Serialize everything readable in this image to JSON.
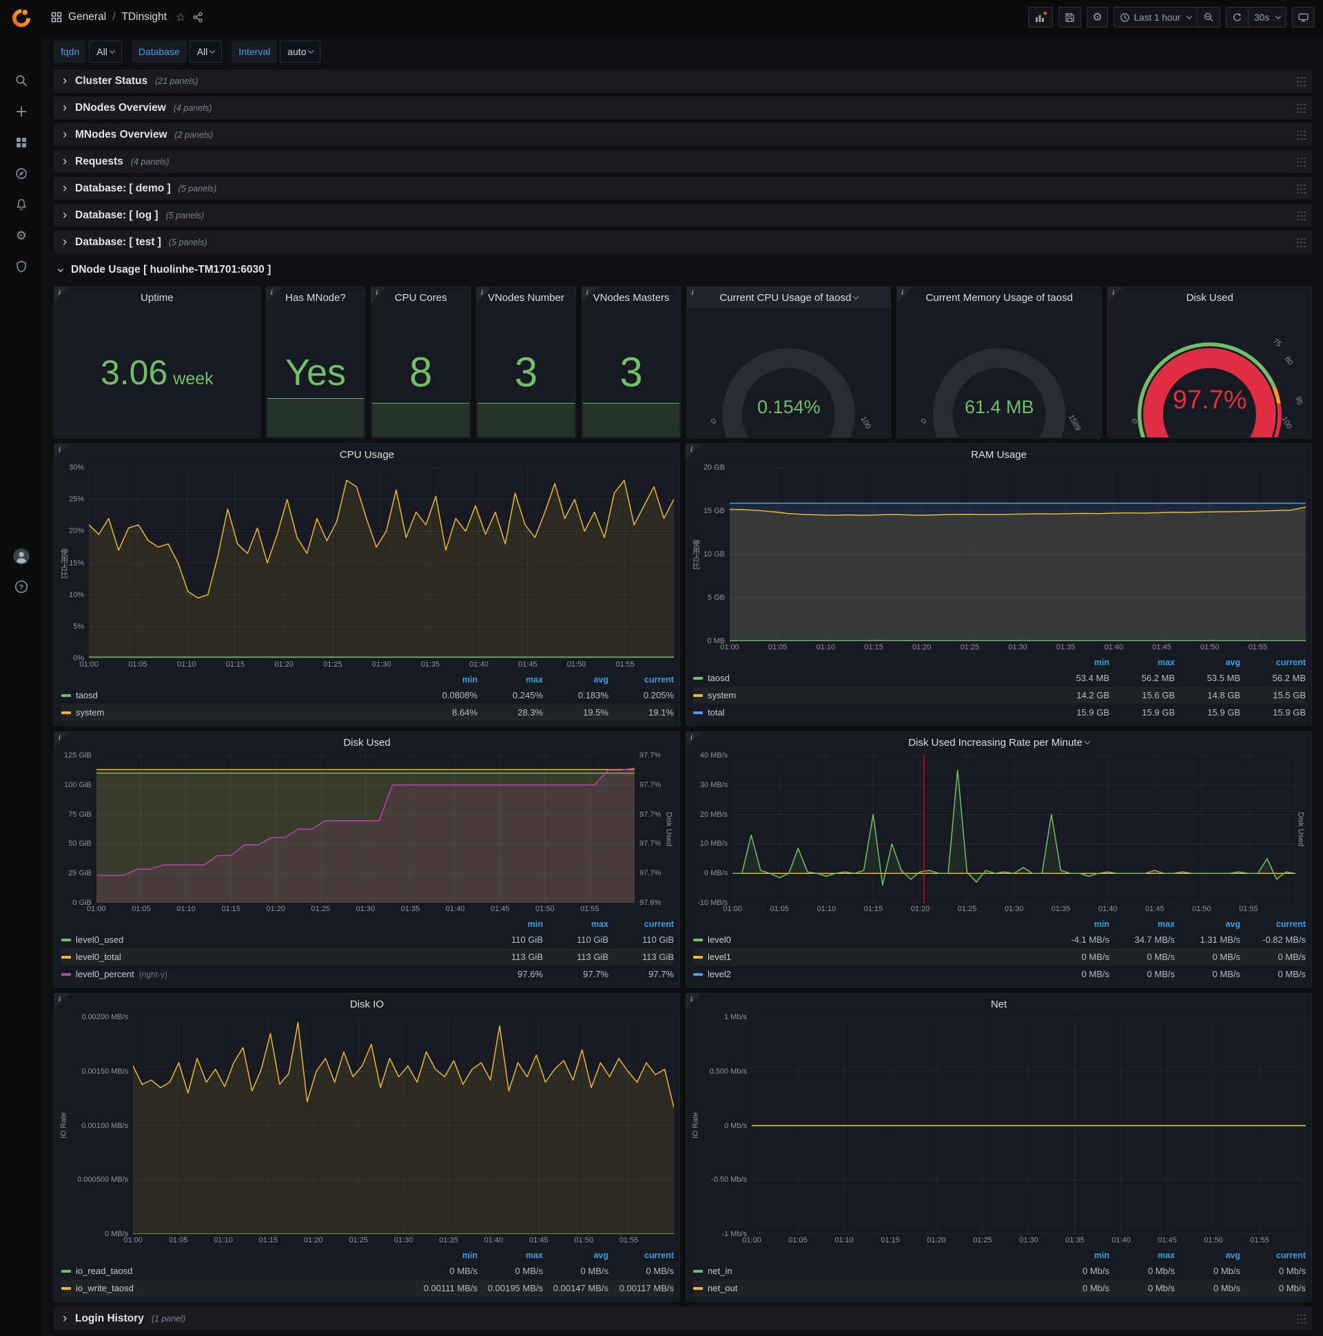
{
  "topbar": {
    "breadcrumb_section": "General",
    "breadcrumb_sep": "/",
    "breadcrumb_page": "TDinsight",
    "time_range": "Last 1 hour",
    "refresh_interval": "30s"
  },
  "variables": [
    {
      "label": "fqdn",
      "value": "All"
    },
    {
      "label": "Database",
      "value": "All"
    },
    {
      "label": "Interval",
      "value": "auto"
    }
  ],
  "collapsed_rows": [
    {
      "title": "Cluster Status",
      "count": "(21 panels)"
    },
    {
      "title": "DNodes Overview",
      "count": "(4 panels)"
    },
    {
      "title": "MNodes Overview",
      "count": "(2 panels)"
    },
    {
      "title": "Requests",
      "count": "(4 panels)"
    },
    {
      "title": "Database: [ demo ]",
      "count": "(5 panels)"
    },
    {
      "title": "Database: [ log ]",
      "count": "(5 panels)"
    },
    {
      "title": "Database: [ test ]",
      "count": "(5 panels)"
    }
  ],
  "expanded_row": {
    "title": "DNode Usage [ huolinhe-TM1701:6030 ]"
  },
  "bottom_row": {
    "title": "Login History",
    "count": "(1 panel)"
  },
  "colors": {
    "green": "#73bf69",
    "yellow": "#eab839",
    "blue": "#5794f2",
    "purple": "#ba43a9",
    "red": "#e02f44",
    "orange": "#ff9830",
    "annotation": "#d10a2d",
    "legend_header": "#33a2e5"
  },
  "stats": [
    {
      "title": "Uptime",
      "value": "3.06",
      "unit": "week",
      "spark": 0
    },
    {
      "title": "Has MNode?",
      "value": "Yes",
      "unit": "",
      "spark": 0.3
    },
    {
      "title": "CPU Cores",
      "value": "8",
      "unit": "",
      "spark": 0.26
    },
    {
      "title": "VNodes Number",
      "value": "3",
      "unit": "",
      "spark": 0.26
    },
    {
      "title": "VNodes Masters",
      "value": "3",
      "unit": "",
      "spark": 0.26
    }
  ],
  "gauges": [
    {
      "id": "cpu-gauge",
      "title": "Current CPU Usage of taosd",
      "dropdown": true,
      "hl": true,
      "value": "0.154%",
      "fraction": 0.012,
      "style": "plain",
      "min_label": "0",
      "max_label": "100"
    },
    {
      "id": "mem-gauge",
      "title": "Current Memory Usage of taosd",
      "dropdown": false,
      "hl": false,
      "value": "61.4 MB",
      "fraction": 0.0386,
      "style": "plain",
      "min_label": "0",
      "max_label": "1589"
    },
    {
      "id": "disk-gauge",
      "title": "Disk Used",
      "dropdown": false,
      "hl": false,
      "value": "97.7%",
      "fraction": 0.977,
      "style": "threshold",
      "min_label": "0",
      "max_label": "100",
      "threshold_labels": [
        "75",
        "80",
        "95"
      ]
    }
  ],
  "charts": [
    {
      "id": "cpu-usage",
      "title": "CPU Usage",
      "dropdown": false,
      "y_label": "使用占比",
      "ymin": 0,
      "ymax": 30,
      "y_ticks": [
        "30%",
        "25%",
        "20%",
        "15%",
        "10%",
        "5%",
        "0%"
      ],
      "x_ticks": [
        "01:00",
        "01:05",
        "01:10",
        "01:15",
        "01:20",
        "01:25",
        "01:30",
        "01:35",
        "01:40",
        "01:45",
        "01:50",
        "01:55"
      ],
      "series": [
        {
          "name": "system",
          "color": "#eab839",
          "fill": 0.1,
          "values": [
            21,
            19.5,
            22,
            17,
            20.5,
            21,
            18.5,
            17.5,
            18,
            15,
            10.5,
            9.5,
            10,
            16,
            23.5,
            18,
            16.5,
            20.5,
            15,
            19.5,
            25,
            19,
            16.5,
            22,
            18.5,
            21.5,
            28,
            27,
            22,
            17.5,
            20,
            26.5,
            19,
            23,
            21,
            25.5,
            17,
            22,
            20,
            24,
            19.5,
            23,
            18,
            26,
            21,
            19,
            23,
            27.5,
            22,
            25,
            20,
            23,
            19,
            26,
            28,
            21,
            24,
            27,
            22,
            25
          ]
        },
        {
          "name": "taosd",
          "color": "#73bf69",
          "fill": 0,
          "values": [
            0.2,
            0.2
          ]
        }
      ],
      "legend": {
        "cols": [
          "min",
          "max",
          "avg",
          "current"
        ],
        "rows": [
          {
            "name": "taosd",
            "color": "#73bf69",
            "values": [
              "0.0808%",
              "0.245%",
              "0.183%",
              "0.205%"
            ]
          },
          {
            "name": "system",
            "color": "#eab839",
            "values": [
              "8.64%",
              "28.3%",
              "19.5%",
              "19.1%"
            ]
          }
        ]
      }
    },
    {
      "id": "ram-usage",
      "title": "RAM Usage",
      "dropdown": false,
      "y_label": "使用占比",
      "ymin": 0,
      "ymax": 20,
      "y_ticks": [
        "20 GB",
        "15 GB",
        "10 GB",
        "5 GB",
        "0 MB"
      ],
      "x_ticks": [
        "01:00",
        "01:05",
        "01:10",
        "01:15",
        "01:20",
        "01:25",
        "01:30",
        "01:35",
        "01:40",
        "01:45",
        "01:50",
        "01:55"
      ],
      "series": [
        {
          "name": "total",
          "color": "#5794f2",
          "fill": 0.12,
          "values": [
            15.9,
            15.9
          ]
        },
        {
          "name": "system",
          "color": "#eab839",
          "fill": 0.12,
          "values": [
            15.2,
            15.15,
            15.05,
            14.9,
            14.7,
            14.6,
            14.55,
            14.5,
            14.55,
            14.5,
            14.55,
            14.6,
            14.55,
            14.5,
            14.55,
            14.6,
            14.62,
            14.6,
            14.58,
            14.62,
            14.65,
            14.68,
            14.65,
            14.7,
            14.72,
            14.7,
            14.75,
            14.78,
            14.75,
            14.8,
            14.85,
            14.82,
            14.88,
            14.9,
            14.92,
            14.95,
            15.0,
            15.05,
            15.1,
            15.45
          ]
        },
        {
          "name": "taosd",
          "color": "#73bf69",
          "fill": 0,
          "values": [
            0.055,
            0.055
          ]
        }
      ],
      "legend": {
        "cols": [
          "min",
          "max",
          "avg",
          "current"
        ],
        "rows": [
          {
            "name": "taosd",
            "color": "#73bf69",
            "values": [
              "53.4 MB",
              "56.2 MB",
              "53.5 MB",
              "56.2 MB"
            ]
          },
          {
            "name": "system",
            "color": "#eab839",
            "values": [
              "14.2 GB",
              "15.6 GB",
              "14.8 GB",
              "15.5 GB"
            ]
          },
          {
            "name": "total",
            "color": "#5794f2",
            "values": [
              "15.9 GB",
              "15.9 GB",
              "15.9 GB",
              "15.9 GB"
            ]
          }
        ]
      }
    },
    {
      "id": "disk-used",
      "title": "Disk Used",
      "dropdown": false,
      "ymin": 0,
      "ymax": 125,
      "y_ticks": [
        "125 GiB",
        "100 GiB",
        "75 GiB",
        "50 GiB",
        "25 GiB",
        "0 GiB"
      ],
      "right_ticks": [
        "97.7%",
        "97.7%",
        "97.7%",
        "97.7%",
        "97.7%",
        "97.6%"
      ],
      "right_label": "Disk Used",
      "right_ymin": 97.58,
      "right_ymax": 97.72,
      "x_ticks": [
        "01:00",
        "01:05",
        "01:10",
        "01:15",
        "01:20",
        "01:25",
        "01:30",
        "01:35",
        "01:40",
        "01:45",
        "01:50",
        "01:55"
      ],
      "series": [
        {
          "name": "level0_total",
          "color": "#eab839",
          "fill": 0.12,
          "values": [
            113,
            113
          ]
        },
        {
          "name": "level0_used",
          "color": "#73bf69",
          "fill": 0.12,
          "values": [
            110,
            110
          ]
        },
        {
          "name": "level0_percent",
          "color": "#ba43a9",
          "axis": "right",
          "fill": 0.12,
          "values": [
            97.606,
            97.606,
            97.606,
            97.612,
            97.612,
            97.616,
            97.616,
            97.616,
            97.616,
            97.625,
            97.625,
            97.635,
            97.635,
            97.642,
            97.642,
            97.65,
            97.65,
            97.658,
            97.658,
            97.658,
            97.658,
            97.658,
            97.692,
            97.692,
            97.692,
            97.692,
            97.692,
            97.692,
            97.692,
            97.692,
            97.692,
            97.692,
            97.692,
            97.692,
            97.692,
            97.692,
            97.692,
            97.692,
            97.706,
            97.706,
            97.708
          ]
        }
      ],
      "legend": {
        "cols": [
          "min",
          "max",
          "current"
        ],
        "rows": [
          {
            "name": "level0_used",
            "color": "#73bf69",
            "values": [
              "110 GiB",
              "110 GiB",
              "110 GiB"
            ]
          },
          {
            "name": "level0_total",
            "color": "#eab839",
            "values": [
              "113 GiB",
              "113 GiB",
              "113 GiB"
            ]
          },
          {
            "name": "level0_percent",
            "suffix": "(right-y)",
            "color": "#ba43a9",
            "values": [
              "97.6%",
              "97.7%",
              "97.7%"
            ]
          }
        ]
      }
    },
    {
      "id": "disk-rate",
      "title": "Disk Used Increasing Rate per Minute",
      "dropdown": true,
      "ymin": -10,
      "ymax": 40,
      "y_ticks": [
        "40 MB/s",
        "30 MB/s",
        "20 MB/s",
        "10 MB/s",
        "0 MB/s",
        "-10 MB/s"
      ],
      "right_label": "Disk Used",
      "annotation_x": 0.34,
      "x_ticks": [
        "01:00",
        "01:05",
        "01:10",
        "01:15",
        "01:20",
        "01:25",
        "01:30",
        "01:35",
        "01:40",
        "01:45",
        "01:50",
        "01:55"
      ],
      "series": [
        {
          "name": "level2",
          "color": "#5794f2",
          "fill": 0,
          "values": [
            0,
            0
          ]
        },
        {
          "name": "level1",
          "color": "#eab839",
          "fill": 0,
          "values": [
            0,
            0
          ]
        },
        {
          "name": "level0",
          "color": "#73bf69",
          "fill": 0.1,
          "values": [
            0,
            0,
            13,
            1,
            0,
            -1.5,
            0,
            8.5,
            0.5,
            0,
            -1,
            0,
            0.5,
            0,
            1,
            20,
            -4,
            10,
            1,
            -2,
            0.5,
            1,
            0,
            0,
            35,
            0.5,
            -3,
            1,
            0,
            0.5,
            0,
            2,
            0,
            0,
            20,
            1,
            0,
            0,
            -1,
            0,
            0.5,
            0,
            0,
            0,
            0,
            1,
            0,
            0,
            0.5,
            0,
            0,
            0,
            0,
            0,
            0.5,
            0,
            0,
            5,
            -2,
            0.5,
            0
          ]
        }
      ],
      "legend": {
        "cols": [
          "min",
          "max",
          "avg",
          "current"
        ],
        "rows": [
          {
            "name": "level0",
            "color": "#73bf69",
            "values": [
              "-4.1 MB/s",
              "34.7 MB/s",
              "1.31 MB/s",
              "-0.82 MB/s"
            ]
          },
          {
            "name": "level1",
            "color": "#eab839",
            "values": [
              "0 MB/s",
              "0 MB/s",
              "0 MB/s",
              "0 MB/s"
            ]
          },
          {
            "name": "level2",
            "color": "#5794f2",
            "values": [
              "0 MB/s",
              "0 MB/s",
              "0 MB/s",
              "0 MB/s"
            ]
          }
        ]
      }
    },
    {
      "id": "disk-io",
      "title": "Disk IO",
      "dropdown": false,
      "y_label": "IO Rate",
      "ymin": 0,
      "ymax": 0.002,
      "y_ticks": [
        "0.00200 MB/s",
        "0.00150 MB/s",
        "0.00100 MB/s",
        "0.000500 MB/s",
        "0 MB/s"
      ],
      "x_ticks": [
        "01:00",
        "01:05",
        "01:10",
        "01:15",
        "01:20",
        "01:25",
        "01:30",
        "01:35",
        "01:40",
        "01:45",
        "01:50",
        "01:55"
      ],
      "series": [
        {
          "name": "io_write_taosd",
          "color": "#eab839",
          "fill": 0.1,
          "values": [
            0.00155,
            0.00138,
            0.00142,
            0.00135,
            0.0014,
            0.00158,
            0.0013,
            0.00162,
            0.0014,
            0.00152,
            0.00136,
            0.00158,
            0.00172,
            0.00132,
            0.00152,
            0.00185,
            0.00138,
            0.00148,
            0.00195,
            0.00122,
            0.0015,
            0.00162,
            0.0014,
            0.00168,
            0.00145,
            0.00155,
            0.00175,
            0.00135,
            0.00162,
            0.00145,
            0.00155,
            0.0014,
            0.00168,
            0.00152,
            0.00145,
            0.0016,
            0.00138,
            0.00152,
            0.00158,
            0.00142,
            0.00192,
            0.00132,
            0.00158,
            0.00145,
            0.00165,
            0.0014,
            0.00152,
            0.0016,
            0.00142,
            0.0017,
            0.00135,
            0.00158,
            0.00145,
            0.00162,
            0.0015,
            0.0014,
            0.00158,
            0.00147,
            0.00152,
            0.00117
          ]
        },
        {
          "name": "io_read_taosd",
          "color": "#73bf69",
          "fill": 0,
          "values": [
            0,
            0
          ]
        }
      ],
      "legend": {
        "cols": [
          "min",
          "max",
          "avg",
          "current"
        ],
        "rows": [
          {
            "name": "io_read_taosd",
            "color": "#73bf69",
            "values": [
              "0 MB/s",
              "0 MB/s",
              "0 MB/s",
              "0 MB/s"
            ]
          },
          {
            "name": "io_write_taosd",
            "color": "#eab839",
            "values": [
              "0.00111 MB/s",
              "0.00195 MB/s",
              "0.00147 MB/s",
              "0.00117 MB/s"
            ]
          }
        ]
      }
    },
    {
      "id": "net",
      "title": "Net",
      "dropdown": false,
      "y_label": "IO Rate",
      "ymin": -1,
      "ymax": 1,
      "y_ticks": [
        "1 Mb/s",
        "0.500 Mb/s",
        "0 Mb/s",
        "-0.50 Mb/s",
        "-1 Mb/s"
      ],
      "x_ticks": [
        "01:00",
        "01:05",
        "01:10",
        "01:15",
        "01:20",
        "01:25",
        "01:30",
        "01:35",
        "01:40",
        "01:45",
        "01:50",
        "01:55"
      ],
      "series": [
        {
          "name": "net_in",
          "color": "#73bf69",
          "fill": 0,
          "values": [
            0,
            0
          ]
        },
        {
          "name": "net_out",
          "color": "#eab839",
          "fill": 0,
          "values": [
            0,
            0
          ]
        }
      ],
      "legend": {
        "cols": [
          "min",
          "max",
          "avg",
          "current"
        ],
        "rows": [
          {
            "name": "net_in",
            "color": "#73bf69",
            "values": [
              "0 Mb/s",
              "0 Mb/s",
              "0 Mb/s",
              "0 Mb/s"
            ]
          },
          {
            "name": "net_out",
            "color": "#eab839",
            "values": [
              "0 Mb/s",
              "0 Mb/s",
              "0 Mb/s",
              "0 Mb/s"
            ]
          }
        ]
      }
    }
  ]
}
